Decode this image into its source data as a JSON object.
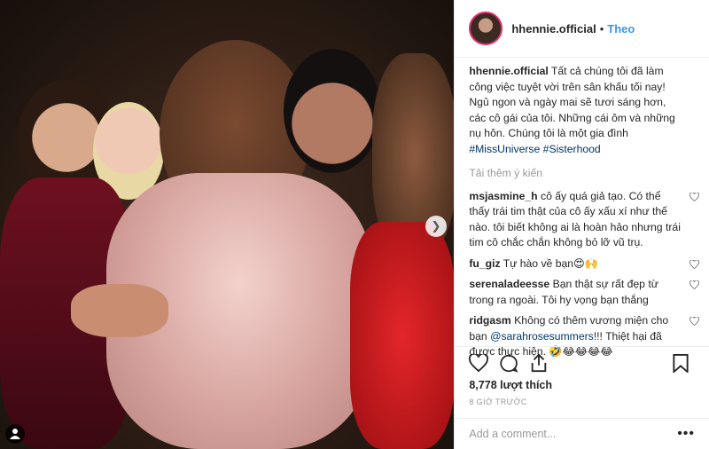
{
  "header": {
    "username": "hhennie.official",
    "dot": "•",
    "follow_label": "Theo"
  },
  "caption": {
    "username": "hhennie.official",
    "text": "Tất cả chúng tôi đã làm công việc tuyệt vời trên sân khấu tối nay! Ngủ ngon và ngày mai sẽ tươi sáng hơn, các cô gái của tôi. Những cái ôm và những nụ hôn. Chúng tôi là một gia đình",
    "hashtag1": "#MissUniverse",
    "hashtag2": "#Sisterhood"
  },
  "load_more": "Tải thêm ý kiến",
  "comments": [
    {
      "username": "msjasmine_h",
      "text": "cô ấy quá giả tạo. Có thể thấy trái tim thật của cô ấy xấu xí như thế nào. tôi biết không ai là hoàn hảo nhưng trái tim cô chắc chắn không bỏ lỡ vũ trụ."
    },
    {
      "username": "fu_giz",
      "text": "Tự hào về bạn😍🙌"
    },
    {
      "username": "serenaladeesse",
      "text": "Bạn thật sự rất đẹp từ trong ra ngoài. Tôi hy vọng bạn thắng"
    },
    {
      "username": "ridgasm",
      "text_before": "Không có thêm vương miện cho bạn ",
      "mention": "@sarahrosesummers",
      "text_after": "!!! Thiệt hại đã được thực hiện. 🤣😂😂😂😂"
    }
  ],
  "likes": "8,778 lượt thích",
  "time": "8 GIỜ TRƯỚC",
  "add_comment_placeholder": "Add a comment...",
  "more_options": "•••",
  "icons": [
    "heart-icon",
    "comment-icon",
    "share-icon",
    "bookmark-icon",
    "chevron-right-icon",
    "user-tag-icon",
    "more-options-icon"
  ],
  "colors": {
    "follow": "#3897f0",
    "link": "#003569",
    "muted": "#999999",
    "text": "#262626"
  }
}
